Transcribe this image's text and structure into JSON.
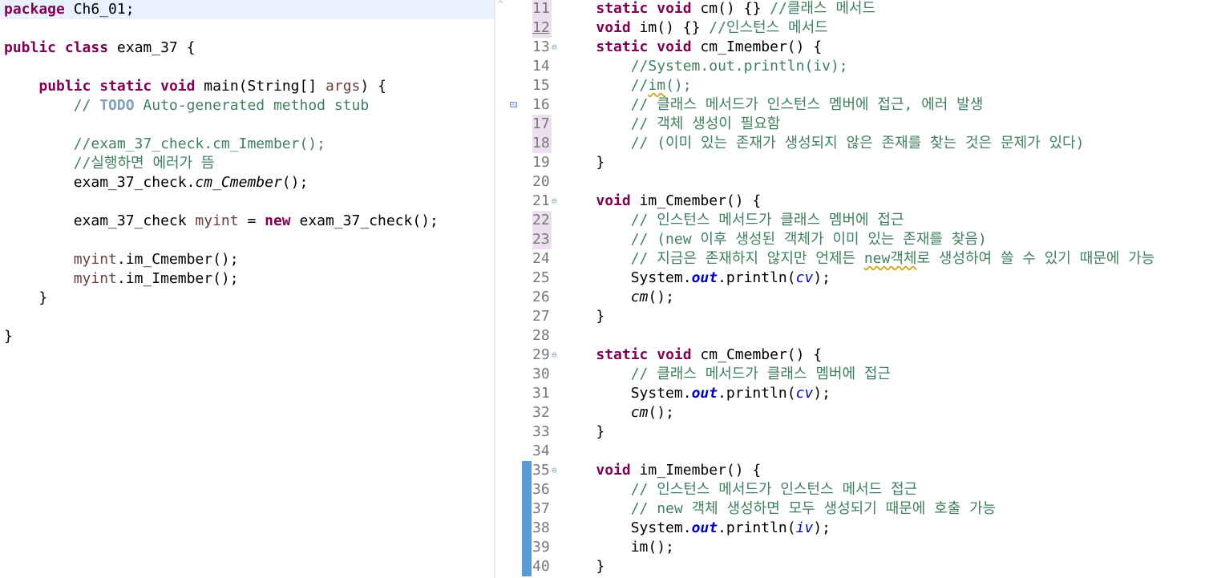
{
  "left_editor": {
    "lines": [
      [
        {
          "t": "package",
          "c": "kw"
        },
        {
          "t": " Ch6_01;"
        }
      ],
      [],
      [
        {
          "t": "public",
          "c": "kw"
        },
        {
          "t": " "
        },
        {
          "t": "class",
          "c": "kw"
        },
        {
          "t": " exam_37 {"
        }
      ],
      [],
      [
        {
          "t": "    "
        },
        {
          "t": "public",
          "c": "kw"
        },
        {
          "t": " "
        },
        {
          "t": "static",
          "c": "kw"
        },
        {
          "t": " "
        },
        {
          "t": "void",
          "c": "kw"
        },
        {
          "t": " main(String[] "
        },
        {
          "t": "args",
          "c": "loc"
        },
        {
          "t": ") {"
        }
      ],
      [
        {
          "t": "        "
        },
        {
          "t": "// ",
          "c": "cm"
        },
        {
          "t": "TODO",
          "c": "todo"
        },
        {
          "t": " Auto-generated method stub",
          "c": "cm"
        }
      ],
      [],
      [
        {
          "t": "        "
        },
        {
          "t": "//exam_37_check.cm_Imember();",
          "c": "cm"
        }
      ],
      [
        {
          "t": "        "
        },
        {
          "t": "//실행하면 에러가 뜸",
          "c": "cm"
        }
      ],
      [
        {
          "t": "        exam_37_check."
        },
        {
          "t": "cm_Cmember",
          "c": "it"
        },
        {
          "t": "();"
        }
      ],
      [],
      [
        {
          "t": "        exam_37_check "
        },
        {
          "t": "myint",
          "c": "loc"
        },
        {
          "t": " = "
        },
        {
          "t": "new",
          "c": "kw"
        },
        {
          "t": " exam_37_check();"
        }
      ],
      [],
      [
        {
          "t": "        "
        },
        {
          "t": "myint",
          "c": "loc"
        },
        {
          "t": ".im_Cmember();"
        }
      ],
      [
        {
          "t": "        "
        },
        {
          "t": "myint",
          "c": "loc"
        },
        {
          "t": ".im_Imember();"
        }
      ],
      [
        {
          "t": "    }"
        }
      ],
      [],
      [
        {
          "t": "}"
        }
      ]
    ]
  },
  "right_editor": {
    "lines": [
      {
        "n": "11",
        "mod": true,
        "u": false,
        "fold": false,
        "segs": [
          {
            "t": "    "
          },
          {
            "t": "static",
            "c": "kw"
          },
          {
            "t": " "
          },
          {
            "t": "void",
            "c": "kw"
          },
          {
            "t": " cm() {} "
          },
          {
            "t": "//클래스 메서드",
            "c": "cm"
          }
        ]
      },
      {
        "n": "12",
        "mod": true,
        "u": true,
        "fold": false,
        "segs": [
          {
            "t": "    "
          },
          {
            "t": "void",
            "c": "kw"
          },
          {
            "t": " im() {} "
          },
          {
            "t": "//인스턴스 메서드",
            "c": "cm"
          }
        ]
      },
      {
        "n": "13",
        "mod": false,
        "u": false,
        "fold": true,
        "segs": [
          {
            "t": "    "
          },
          {
            "t": "static",
            "c": "kw"
          },
          {
            "t": " "
          },
          {
            "t": "void",
            "c": "kw"
          },
          {
            "t": " cm_Imember() {"
          }
        ]
      },
      {
        "n": "14",
        "mod": false,
        "u": false,
        "fold": false,
        "segs": [
          {
            "t": "        "
          },
          {
            "t": "//System.out.println(iv);",
            "c": "cm"
          }
        ]
      },
      {
        "n": "15",
        "mod": false,
        "u": false,
        "fold": false,
        "segs": [
          {
            "t": "        "
          },
          {
            "t": "//",
            "c": "cm"
          },
          {
            "t": "im",
            "c": "cm sq"
          },
          {
            "t": "();",
            "c": "cm"
          }
        ]
      },
      {
        "n": "16",
        "mod": false,
        "u": false,
        "fold": false,
        "segs": [
          {
            "t": "        "
          },
          {
            "t": "// 클래스 메서드가 인스턴스 멤버에 접근, 에러 발생",
            "c": "cm"
          }
        ]
      },
      {
        "n": "17",
        "mod": true,
        "u": false,
        "fold": false,
        "segs": [
          {
            "t": "        "
          },
          {
            "t": "// 객체 생성이 필요함",
            "c": "cm"
          }
        ]
      },
      {
        "n": "18",
        "mod": true,
        "u": false,
        "fold": false,
        "segs": [
          {
            "t": "        "
          },
          {
            "t": "// (이미 있는 존재가 생성되지 않은 존재를 찾는 것은 문제가 있다)",
            "c": "cm"
          }
        ]
      },
      {
        "n": "19",
        "mod": false,
        "u": false,
        "fold": false,
        "segs": [
          {
            "t": "    }"
          }
        ]
      },
      {
        "n": "20",
        "mod": false,
        "u": false,
        "fold": false,
        "segs": []
      },
      {
        "n": "21",
        "mod": false,
        "u": false,
        "fold": true,
        "segs": [
          {
            "t": "    "
          },
          {
            "t": "void",
            "c": "kw"
          },
          {
            "t": " im_Cmember() {"
          }
        ]
      },
      {
        "n": "22",
        "mod": true,
        "u": false,
        "fold": false,
        "segs": [
          {
            "t": "        "
          },
          {
            "t": "// 인스턴스 메서드가 클래스 멤버에 접근",
            "c": "cm"
          }
        ]
      },
      {
        "n": "23",
        "mod": true,
        "u": false,
        "fold": false,
        "segs": [
          {
            "t": "        "
          },
          {
            "t": "// (new 이후 생성된 객체가 이미 있는 존재를 찾음)",
            "c": "cm"
          }
        ]
      },
      {
        "n": "24",
        "mod": false,
        "u": false,
        "fold": false,
        "segs": [
          {
            "t": "        "
          },
          {
            "t": "// 지금은 존재하지 않지만 언제든 ",
            "c": "cm"
          },
          {
            "t": "new객체",
            "c": "cm sq"
          },
          {
            "t": "로 생성하여 쓸 수 있기 때문에 가능",
            "c": "cm"
          }
        ]
      },
      {
        "n": "25",
        "mod": false,
        "u": false,
        "fold": false,
        "segs": [
          {
            "t": "        System."
          },
          {
            "t": "out",
            "c": "sfld"
          },
          {
            "t": ".println("
          },
          {
            "t": "cv",
            "c": "fld"
          },
          {
            "t": ");"
          }
        ]
      },
      {
        "n": "26",
        "mod": false,
        "u": false,
        "fold": false,
        "segs": [
          {
            "t": "        "
          },
          {
            "t": "cm",
            "c": "it"
          },
          {
            "t": "();"
          }
        ]
      },
      {
        "n": "27",
        "mod": false,
        "u": false,
        "fold": false,
        "segs": [
          {
            "t": "    }"
          }
        ]
      },
      {
        "n": "28",
        "mod": false,
        "u": false,
        "fold": false,
        "segs": []
      },
      {
        "n": "29",
        "mod": false,
        "u": false,
        "fold": true,
        "segs": [
          {
            "t": "    "
          },
          {
            "t": "static",
            "c": "kw"
          },
          {
            "t": " "
          },
          {
            "t": "void",
            "c": "kw"
          },
          {
            "t": " cm_Cmember() {"
          }
        ]
      },
      {
        "n": "30",
        "mod": false,
        "u": false,
        "fold": false,
        "segs": [
          {
            "t": "        "
          },
          {
            "t": "// 클래스 메서드가 클래스 멤버에 접근",
            "c": "cm"
          }
        ]
      },
      {
        "n": "31",
        "mod": false,
        "u": false,
        "fold": false,
        "segs": [
          {
            "t": "        System."
          },
          {
            "t": "out",
            "c": "sfld"
          },
          {
            "t": ".println("
          },
          {
            "t": "cv",
            "c": "fld"
          },
          {
            "t": ");"
          }
        ]
      },
      {
        "n": "32",
        "mod": false,
        "u": false,
        "fold": false,
        "segs": [
          {
            "t": "        "
          },
          {
            "t": "cm",
            "c": "it"
          },
          {
            "t": "();"
          }
        ]
      },
      {
        "n": "33",
        "mod": false,
        "u": false,
        "fold": false,
        "segs": [
          {
            "t": "    }"
          }
        ]
      },
      {
        "n": "34",
        "mod": false,
        "u": false,
        "fold": false,
        "segs": []
      },
      {
        "n": "35",
        "mod": false,
        "u": false,
        "fold": true,
        "segs": [
          {
            "t": "    "
          },
          {
            "t": "void",
            "c": "kw"
          },
          {
            "t": " im_Imember() {"
          }
        ]
      },
      {
        "n": "36",
        "mod": false,
        "u": false,
        "fold": false,
        "segs": [
          {
            "t": "        "
          },
          {
            "t": "// 인스턴스 메서드가 인스턴스 메서드 접근",
            "c": "cm"
          }
        ]
      },
      {
        "n": "37",
        "mod": false,
        "u": false,
        "fold": false,
        "segs": [
          {
            "t": "        "
          },
          {
            "t": "// new 객체 생성하면 모두 생성되기 때문에 호출 가능",
            "c": "cm"
          }
        ]
      },
      {
        "n": "38",
        "mod": false,
        "u": false,
        "fold": false,
        "segs": [
          {
            "t": "        System."
          },
          {
            "t": "out",
            "c": "sfld"
          },
          {
            "t": ".println("
          },
          {
            "t": "iv",
            "c": "fld"
          },
          {
            "t": ");"
          }
        ]
      },
      {
        "n": "39",
        "mod": false,
        "u": false,
        "fold": false,
        "segs": [
          {
            "t": "        im();"
          }
        ]
      },
      {
        "n": "40",
        "mod": false,
        "u": false,
        "fold": false,
        "segs": [
          {
            "t": "    }"
          }
        ]
      }
    ]
  },
  "icons": {
    "fold": "⊖",
    "scroll_up": "^"
  },
  "colors": {
    "keyword": "#7f0055",
    "comment": "#3f7f5f",
    "field": "#0000c0",
    "current_line": "#e8f2fe",
    "change_bar": "#5b9bd5"
  }
}
